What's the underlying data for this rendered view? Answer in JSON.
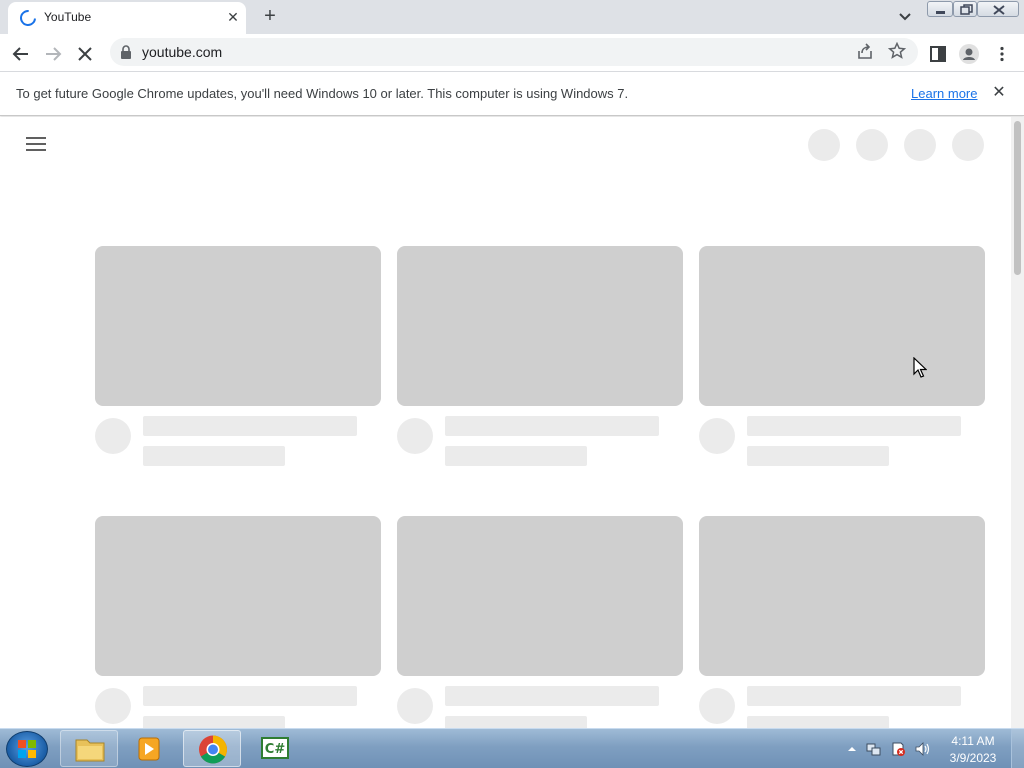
{
  "tab": {
    "title": "YouTube",
    "close": "✕"
  },
  "new_tab": "+",
  "toolbar": {
    "url": "youtube.com"
  },
  "infobar": {
    "message": "To get future Google Chrome updates, you'll need Windows 10 or later. This computer is using Windows 7.",
    "link": "Learn more",
    "close": "✕"
  },
  "page": {
    "state": "loading-skeleton",
    "cards": [
      {
        "placeholder": true
      },
      {
        "placeholder": true
      },
      {
        "placeholder": true
      },
      {
        "placeholder": true
      },
      {
        "placeholder": true
      },
      {
        "placeholder": true
      }
    ]
  },
  "taskbar": {
    "items": [
      "start-orb",
      "windows-explorer",
      "media-player",
      "google-chrome",
      "csharp-editor"
    ],
    "clock": {
      "time": "4:11 AM",
      "date": "3/9/2023"
    }
  },
  "colors": {
    "tabstrip": "#dee1e6",
    "accent": "#1a73e8",
    "skeleton_thumb": "#cfcfcf",
    "skeleton_line": "#ebebeb",
    "taskbar": "#7f9fc1"
  }
}
